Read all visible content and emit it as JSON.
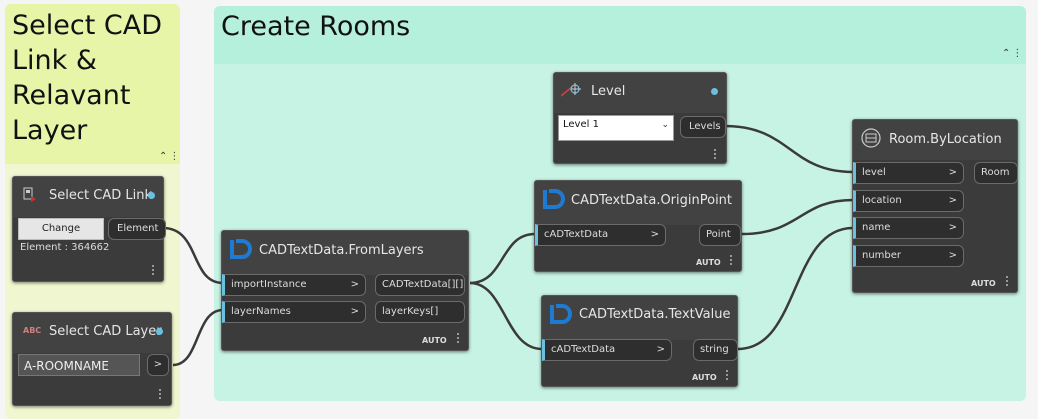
{
  "groups": {
    "select": {
      "title": "Select CAD Link & Relavant Layer",
      "color": "#e6f5a8",
      "body_color": "#f0f7d0"
    },
    "create": {
      "title": "Create Rooms",
      "color": "#b5f0dc",
      "body_color": "#c7f3e4"
    }
  },
  "nodes": {
    "select_cad_link": {
      "title": "Select CAD Link",
      "button": "Change",
      "element_text": "Element : 364662",
      "output": "Element"
    },
    "select_cad_layer": {
      "title": "Select CAD Layer",
      "icon_text": "ABC",
      "value": "A-ROOMNAME",
      "output": ">"
    },
    "from_layers": {
      "title": "CADTextData.FromLayers",
      "inputs": [
        "importInstance",
        "layerNames"
      ],
      "outputs": [
        "CADTextData[][]",
        "layerKeys[]"
      ],
      "lacing": "AUTO"
    },
    "level": {
      "title": "Level",
      "dropdown": "Level 1",
      "output": "Levels"
    },
    "origin_point": {
      "title": "CADTextData.OriginPoint",
      "input": "cADTextData",
      "output": "Point",
      "lacing": "AUTO"
    },
    "text_value": {
      "title": "CADTextData.TextValue",
      "input": "cADTextData",
      "output": "string",
      "lacing": "AUTO"
    },
    "room": {
      "title": "Room.ByLocation",
      "inputs": [
        "level",
        "location",
        "name",
        "number"
      ],
      "output": "Room",
      "lacing": "AUTO"
    }
  },
  "colors": {
    "port_accent": "#6ac0e0",
    "node_bg": "#3b3b3b",
    "wire": "#3a3a3a",
    "dynamo_blue": "#1f7ad1"
  }
}
